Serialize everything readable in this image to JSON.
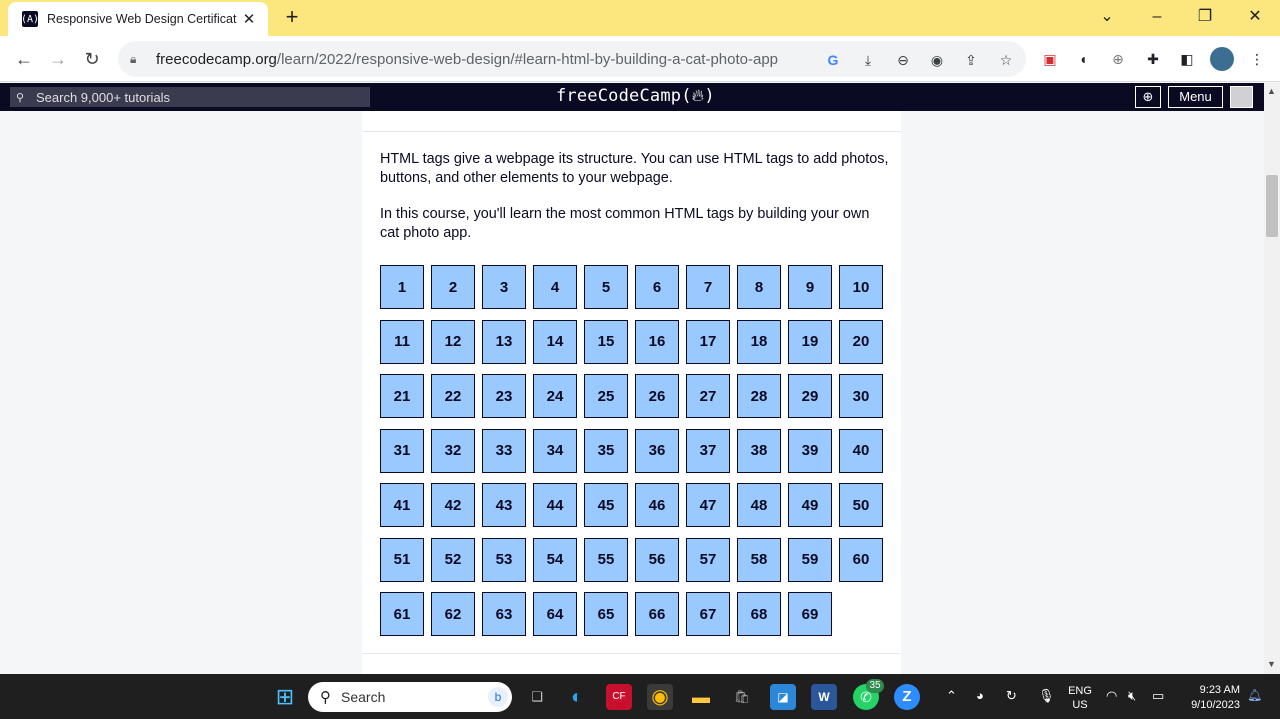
{
  "browser": {
    "tab_title": "Responsive Web Design Certification",
    "new_tab": "+",
    "url_domain": "freecodecamp.org",
    "url_path": "/learn/2022/responsive-web-design/#learn-html-by-building-a-cat-photo-app",
    "window_controls": [
      "chevron-down-icon",
      "minimize-icon",
      "restore-icon",
      "close-icon"
    ]
  },
  "fcc_nav": {
    "search_placeholder": "Search 9,000+ tutorials",
    "logo": "freeCodeCamp(🔥)",
    "logo_text": "freeCodeCamp",
    "menu_label": "Menu"
  },
  "content": {
    "paragraph1": "HTML tags give a webpage its structure. You can use HTML tags to add photos, buttons, and other elements to your webpage.",
    "paragraph2": "In this course, you'll learn the most common HTML tags by building your own cat photo app.",
    "steps": [
      "1",
      "2",
      "3",
      "4",
      "5",
      "6",
      "7",
      "8",
      "9",
      "10",
      "11",
      "12",
      "13",
      "14",
      "15",
      "16",
      "17",
      "18",
      "19",
      "20",
      "21",
      "22",
      "23",
      "24",
      "25",
      "26",
      "27",
      "28",
      "29",
      "30",
      "31",
      "32",
      "33",
      "34",
      "35",
      "36",
      "37",
      "38",
      "39",
      "40",
      "41",
      "42",
      "43",
      "44",
      "45",
      "46",
      "47",
      "48",
      "49",
      "50",
      "51",
      "52",
      "53",
      "54",
      "55",
      "56",
      "57",
      "58",
      "59",
      "60",
      "61",
      "62",
      "63",
      "64",
      "65",
      "66",
      "67",
      "68",
      "69"
    ]
  },
  "taskbar": {
    "search_text": "Search",
    "whatsapp_badge": "35",
    "language": "ENG",
    "region": "US",
    "time": "9:23 AM",
    "date": "9/10/2023"
  },
  "colors": {
    "tabstrip": "#fbe77e",
    "fcc_dark": "#0a0a23",
    "step_fill": "#99c9ff"
  }
}
